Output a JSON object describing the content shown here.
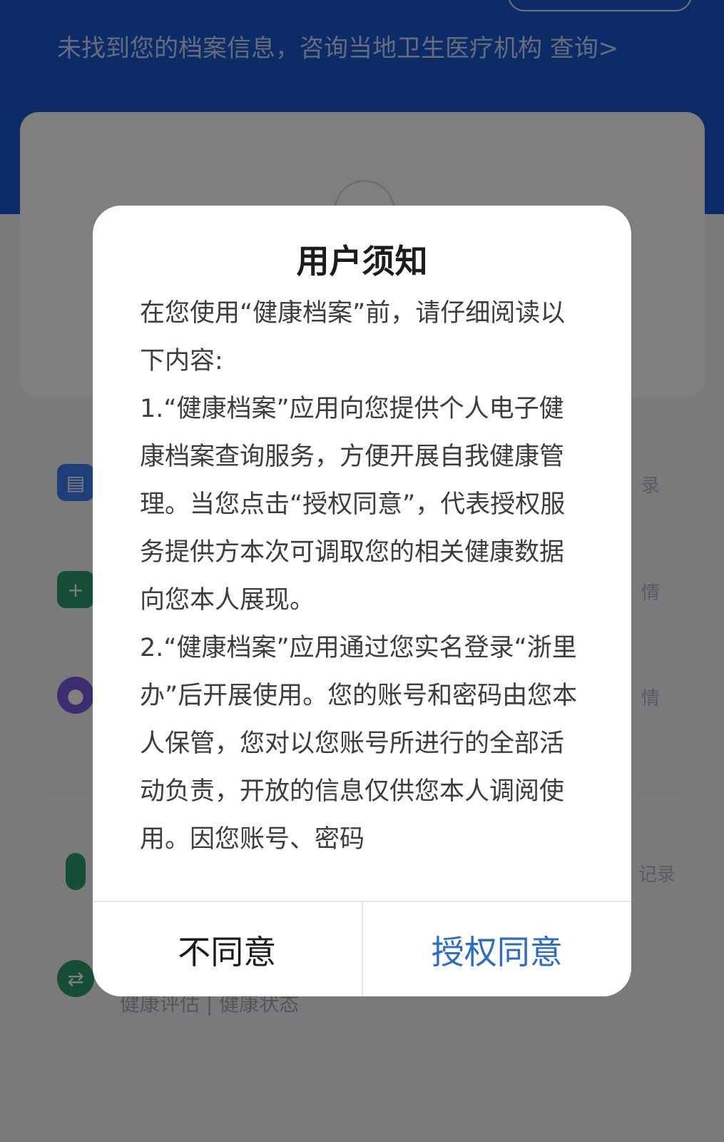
{
  "header": {
    "notice": "未找到您的档案信息，咨询当地卫生医疗机构 查询>"
  },
  "menu": {
    "items": [
      {
        "icon": "document-icon",
        "tail": "录",
        "color": "#3b7cf0"
      },
      {
        "icon": "home-plus-icon",
        "tail": "情",
        "color": "#2a9d6a"
      },
      {
        "icon": "pill-icon",
        "tail": "情",
        "color": "#7b5be0"
      },
      {
        "icon": "thermometer-icon",
        "tail": "记录",
        "color": "#2a9d6a"
      },
      {
        "icon": "chat-exchange-icon",
        "tail": "",
        "color": "#2a9d6a"
      }
    ],
    "sub_label": "健康评估 | 健康状态"
  },
  "dialog": {
    "title": "用户须知",
    "paragraphs": [
      "在您使用“健康档案”前，请仔细阅读以下内容:",
      "1.“健康档案”应用向您提供个人电子健康档案查询服务，方便开展自我健康管理。当您点击“授权同意”，代表授权服务提供方本次可调取您的相关健康数据向您本人展现。",
      "2.“健康档案”应用通过您实名登录“浙里办”后开展使用。您的账号和密码由您本人保管，您对以您账号所进行的全部活动负责，开放的信息仅供您本人调阅使用。因您账号、密码"
    ],
    "decline_label": "不同意",
    "accept_label": "授权同意"
  },
  "colors": {
    "header_bg": "#1a57cf",
    "accept_text": "#2b6cc8",
    "overlay": "rgba(0,0,0,0.5)"
  }
}
